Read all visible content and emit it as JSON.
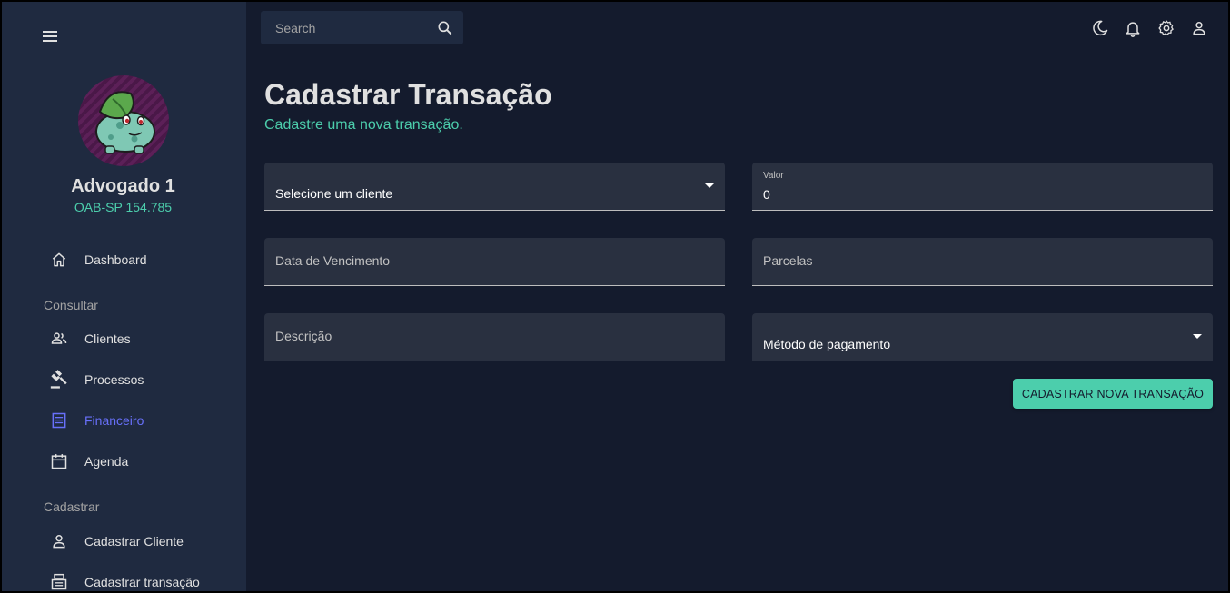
{
  "sidebar": {
    "profile": {
      "name": "Advogado 1",
      "oab": "OAB-SP 154.785"
    },
    "items": [
      {
        "label": "Dashboard",
        "icon": "home-icon"
      },
      {
        "section": "Consultar"
      },
      {
        "label": "Clientes",
        "icon": "people-icon"
      },
      {
        "label": "Processos",
        "icon": "gavel-icon"
      },
      {
        "label": "Financeiro",
        "icon": "receipt-icon",
        "active": true
      },
      {
        "label": "Agenda",
        "icon": "calendar-icon"
      },
      {
        "section": "Cadastrar"
      },
      {
        "label": "Cadastrar Cliente",
        "icon": "person-icon"
      },
      {
        "label": "Cadastrar transação",
        "icon": "register-icon"
      }
    ]
  },
  "topbar": {
    "search": {
      "placeholder": "Search"
    },
    "icons": [
      "dark-mode-icon",
      "notifications-icon",
      "settings-icon",
      "account-icon"
    ]
  },
  "main": {
    "title": "Cadastrar Transação",
    "subtitle": "Cadastre uma nova transação.",
    "form": {
      "cliente": {
        "placeholder": "Selecione um cliente"
      },
      "valor": {
        "label": "Valor",
        "value": "0"
      },
      "vencimento": {
        "label": "Data de Vencimento"
      },
      "parcelas": {
        "label": "Parcelas"
      },
      "descricao": {
        "label": "Descrição"
      },
      "metodo": {
        "placeholder": "Método de pagamento"
      },
      "submit_label": "CADASTRAR NOVA TRANSAÇÃO"
    }
  },
  "colors": {
    "background": "#141b2d",
    "sidebar": "#1f2a40",
    "accent_green": "#4cceac",
    "accent_blue": "#6870fa",
    "field": "#293040"
  }
}
